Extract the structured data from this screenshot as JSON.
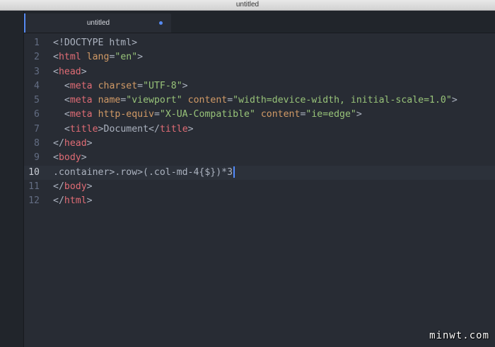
{
  "window": {
    "title": "untitled"
  },
  "tab": {
    "label": "untitled",
    "modified": true
  },
  "colors": {
    "tag": "#e06c75",
    "attribute": "#d19a66",
    "string": "#98c379",
    "text": "#abb2bf",
    "cursor": "#528bff"
  },
  "editor": {
    "active_line": 10,
    "lines": [
      {
        "num": "1",
        "text": "<!DOCTYPE html>"
      },
      {
        "num": "2",
        "text": "<html lang=\"en\">"
      },
      {
        "num": "3",
        "text": "<head>"
      },
      {
        "num": "4",
        "text": "  <meta charset=\"UTF-8\">"
      },
      {
        "num": "5",
        "text": "  <meta name=\"viewport\" content=\"width=device-width, initial-scale=1.0\">"
      },
      {
        "num": "6",
        "text": "  <meta http-equiv=\"X-UA-Compatible\" content=\"ie=edge\">"
      },
      {
        "num": "7",
        "text": "  <title>Document</title>"
      },
      {
        "num": "8",
        "text": "</head>"
      },
      {
        "num": "9",
        "text": "<body>"
      },
      {
        "num": "10",
        "text": ".container>.row>(.col-md-4{$})*3"
      },
      {
        "num": "11",
        "text": "</body>"
      },
      {
        "num": "12",
        "text": "</html>"
      }
    ]
  },
  "watermark": "minwt.com"
}
